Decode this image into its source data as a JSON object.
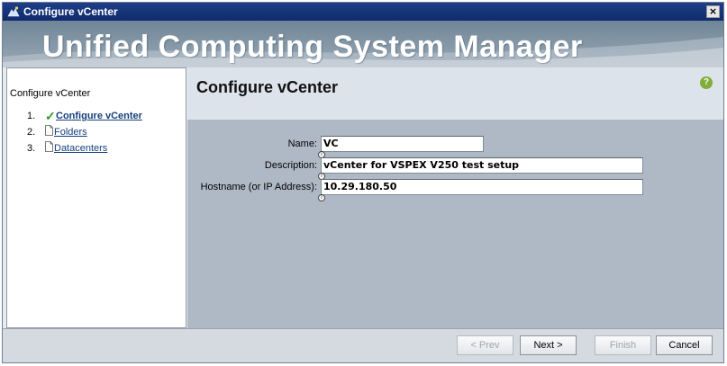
{
  "window": {
    "title": "Configure vCenter",
    "close_glyph": "×"
  },
  "banner": {
    "title": "Unified Computing System Manager"
  },
  "left_panel": {
    "title": "Configure vCenter",
    "steps": [
      {
        "number": "1.",
        "label": "Configure vCenter",
        "state": "complete",
        "icon": "checkmark-icon"
      },
      {
        "number": "2.",
        "label": "Folders",
        "state": "pending",
        "icon": "page-icon"
      },
      {
        "number": "3.",
        "label": "Datacenters",
        "state": "pending",
        "icon": "page-icon"
      }
    ]
  },
  "main": {
    "title": "Configure vCenter",
    "help_glyph": "?",
    "fields": {
      "name": {
        "label": "Name:",
        "value": "VC"
      },
      "description": {
        "label": "Description:",
        "value": "vCenter for VSPEX V250 test setup"
      },
      "hostname": {
        "label": "Hostname (or IP Address):",
        "value": "10.29.180.50"
      }
    }
  },
  "footer": {
    "prev_label": "< Prev",
    "next_label": "Next >",
    "finish_label": "Finish",
    "cancel_label": "Cancel"
  },
  "colors": {
    "titlebar": "#0f2a6e",
    "check": "#2e9a1e",
    "link": "#153f7a",
    "help": "#7fae3a"
  }
}
